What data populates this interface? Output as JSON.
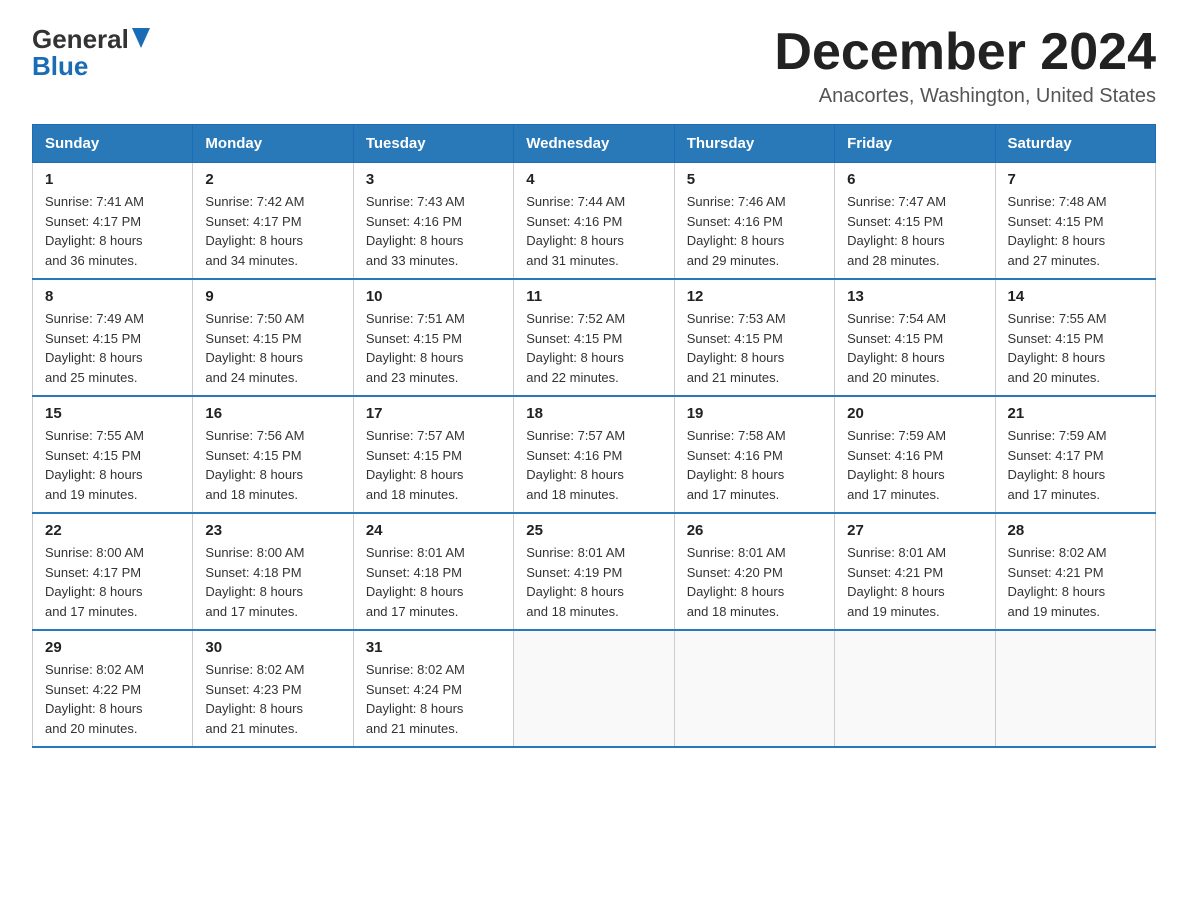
{
  "header": {
    "logo_line1": "General",
    "logo_line2": "Blue",
    "main_title": "December 2024",
    "subtitle": "Anacortes, Washington, United States"
  },
  "days_of_week": [
    "Sunday",
    "Monday",
    "Tuesday",
    "Wednesday",
    "Thursday",
    "Friday",
    "Saturday"
  ],
  "weeks": [
    [
      {
        "day": "1",
        "sunrise": "7:41 AM",
        "sunset": "4:17 PM",
        "daylight": "8 hours and 36 minutes."
      },
      {
        "day": "2",
        "sunrise": "7:42 AM",
        "sunset": "4:17 PM",
        "daylight": "8 hours and 34 minutes."
      },
      {
        "day": "3",
        "sunrise": "7:43 AM",
        "sunset": "4:16 PM",
        "daylight": "8 hours and 33 minutes."
      },
      {
        "day": "4",
        "sunrise": "7:44 AM",
        "sunset": "4:16 PM",
        "daylight": "8 hours and 31 minutes."
      },
      {
        "day": "5",
        "sunrise": "7:46 AM",
        "sunset": "4:16 PM",
        "daylight": "8 hours and 29 minutes."
      },
      {
        "day": "6",
        "sunrise": "7:47 AM",
        "sunset": "4:15 PM",
        "daylight": "8 hours and 28 minutes."
      },
      {
        "day": "7",
        "sunrise": "7:48 AM",
        "sunset": "4:15 PM",
        "daylight": "8 hours and 27 minutes."
      }
    ],
    [
      {
        "day": "8",
        "sunrise": "7:49 AM",
        "sunset": "4:15 PM",
        "daylight": "8 hours and 25 minutes."
      },
      {
        "day": "9",
        "sunrise": "7:50 AM",
        "sunset": "4:15 PM",
        "daylight": "8 hours and 24 minutes."
      },
      {
        "day": "10",
        "sunrise": "7:51 AM",
        "sunset": "4:15 PM",
        "daylight": "8 hours and 23 minutes."
      },
      {
        "day": "11",
        "sunrise": "7:52 AM",
        "sunset": "4:15 PM",
        "daylight": "8 hours and 22 minutes."
      },
      {
        "day": "12",
        "sunrise": "7:53 AM",
        "sunset": "4:15 PM",
        "daylight": "8 hours and 21 minutes."
      },
      {
        "day": "13",
        "sunrise": "7:54 AM",
        "sunset": "4:15 PM",
        "daylight": "8 hours and 20 minutes."
      },
      {
        "day": "14",
        "sunrise": "7:55 AM",
        "sunset": "4:15 PM",
        "daylight": "8 hours and 20 minutes."
      }
    ],
    [
      {
        "day": "15",
        "sunrise": "7:55 AM",
        "sunset": "4:15 PM",
        "daylight": "8 hours and 19 minutes."
      },
      {
        "day": "16",
        "sunrise": "7:56 AM",
        "sunset": "4:15 PM",
        "daylight": "8 hours and 18 minutes."
      },
      {
        "day": "17",
        "sunrise": "7:57 AM",
        "sunset": "4:15 PM",
        "daylight": "8 hours and 18 minutes."
      },
      {
        "day": "18",
        "sunrise": "7:57 AM",
        "sunset": "4:16 PM",
        "daylight": "8 hours and 18 minutes."
      },
      {
        "day": "19",
        "sunrise": "7:58 AM",
        "sunset": "4:16 PM",
        "daylight": "8 hours and 17 minutes."
      },
      {
        "day": "20",
        "sunrise": "7:59 AM",
        "sunset": "4:16 PM",
        "daylight": "8 hours and 17 minutes."
      },
      {
        "day": "21",
        "sunrise": "7:59 AM",
        "sunset": "4:17 PM",
        "daylight": "8 hours and 17 minutes."
      }
    ],
    [
      {
        "day": "22",
        "sunrise": "8:00 AM",
        "sunset": "4:17 PM",
        "daylight": "8 hours and 17 minutes."
      },
      {
        "day": "23",
        "sunrise": "8:00 AM",
        "sunset": "4:18 PM",
        "daylight": "8 hours and 17 minutes."
      },
      {
        "day": "24",
        "sunrise": "8:01 AM",
        "sunset": "4:18 PM",
        "daylight": "8 hours and 17 minutes."
      },
      {
        "day": "25",
        "sunrise": "8:01 AM",
        "sunset": "4:19 PM",
        "daylight": "8 hours and 18 minutes."
      },
      {
        "day": "26",
        "sunrise": "8:01 AM",
        "sunset": "4:20 PM",
        "daylight": "8 hours and 18 minutes."
      },
      {
        "day": "27",
        "sunrise": "8:01 AM",
        "sunset": "4:21 PM",
        "daylight": "8 hours and 19 minutes."
      },
      {
        "day": "28",
        "sunrise": "8:02 AM",
        "sunset": "4:21 PM",
        "daylight": "8 hours and 19 minutes."
      }
    ],
    [
      {
        "day": "29",
        "sunrise": "8:02 AM",
        "sunset": "4:22 PM",
        "daylight": "8 hours and 20 minutes."
      },
      {
        "day": "30",
        "sunrise": "8:02 AM",
        "sunset": "4:23 PM",
        "daylight": "8 hours and 21 minutes."
      },
      {
        "day": "31",
        "sunrise": "8:02 AM",
        "sunset": "4:24 PM",
        "daylight": "8 hours and 21 minutes."
      },
      null,
      null,
      null,
      null
    ]
  ],
  "labels": {
    "sunrise": "Sunrise:",
    "sunset": "Sunset:",
    "daylight": "Daylight:"
  }
}
